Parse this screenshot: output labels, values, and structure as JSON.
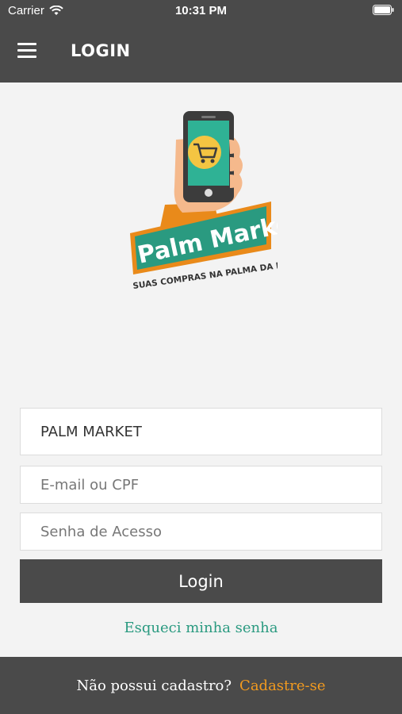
{
  "status_bar": {
    "carrier": "Carrier",
    "time": "10:31 PM",
    "wifi_icon": "wifi-icon",
    "battery_icon": "battery-icon"
  },
  "nav": {
    "title": "LOGIN",
    "menu_icon": "hamburger-menu-icon"
  },
  "logo": {
    "brand": "Palm Market",
    "tagline": "SUAS COMPRAS NA PALMA DA MÃO"
  },
  "form": {
    "company": "PALM MARKET",
    "email_placeholder": "E-mail ou CPF",
    "password_placeholder": "Senha de Acesso",
    "login_label": "Login",
    "forgot_label": "Esqueci minha senha"
  },
  "footer": {
    "question": "Não possui cadastro?",
    "signup_label": "Cadastre-se"
  },
  "colors": {
    "bar": "#4a4a4a",
    "accent_green": "#2a9a80",
    "accent_orange": "#f29a1f"
  }
}
